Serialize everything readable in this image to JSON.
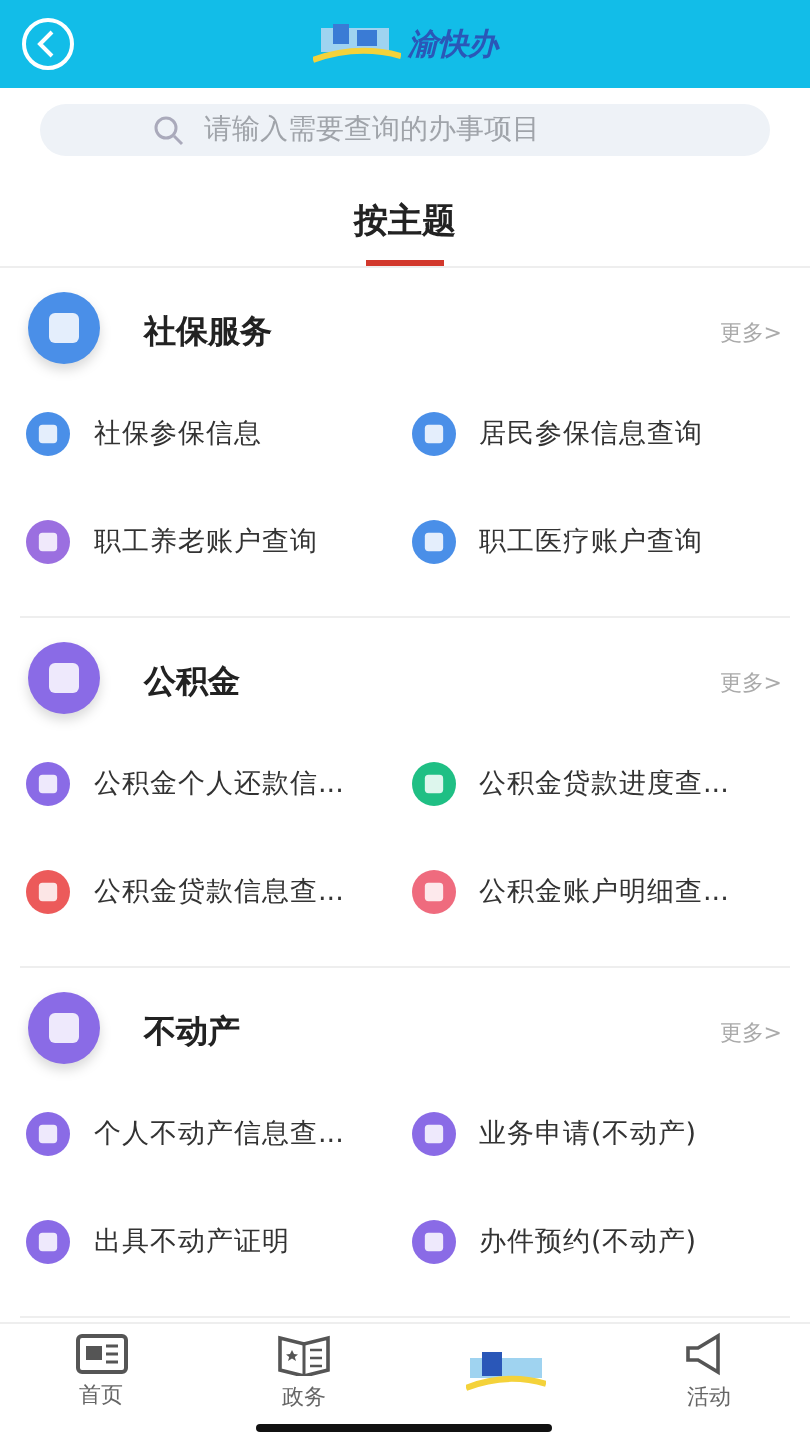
{
  "header": {
    "title": "渝快办"
  },
  "search": {
    "placeholder": "请输入需要查询的办事项目"
  },
  "tabs": [
    {
      "label": "按主题",
      "selected": true
    }
  ],
  "sections": [
    {
      "title": "社保服务",
      "more": "更多>",
      "color": "#4a8fe8",
      "items": [
        {
          "label": "社保参保信息",
          "color": "#4a8fe8"
        },
        {
          "label": "居民参保信息查询",
          "color": "#4a8fe8"
        },
        {
          "label": "职工养老账户查询",
          "color": "#9b6fe0"
        },
        {
          "label": "职工医疗账户查询",
          "color": "#4a8fe8"
        }
      ]
    },
    {
      "title": "公积金",
      "more": "更多>",
      "color": "#8a6be6",
      "items": [
        {
          "label": "公积金个人还款信...",
          "color": "#8a6be6"
        },
        {
          "label": "公积金贷款进度查...",
          "color": "#1fbf84"
        },
        {
          "label": "公积金贷款信息查...",
          "color": "#ec5a5a"
        },
        {
          "label": "公积金账户明细查...",
          "color": "#ef6b7e"
        }
      ]
    },
    {
      "title": "不动产",
      "more": "更多>",
      "color": "#8a6be6",
      "items": [
        {
          "label": "个人不动产信息查...",
          "color": "#8a6be6"
        },
        {
          "label": "业务申请(不动产)",
          "color": "#8a6be6"
        },
        {
          "label": "出具不动产证明",
          "color": "#8a6be6"
        },
        {
          "label": "办件预约(不动产)",
          "color": "#8a6be6"
        }
      ]
    }
  ],
  "bottom_nav": [
    {
      "kind": "news",
      "label": "首页"
    },
    {
      "kind": "book",
      "label": "政务"
    },
    {
      "kind": "logo"
    },
    {
      "kind": "megaphone",
      "label": "活动"
    }
  ]
}
